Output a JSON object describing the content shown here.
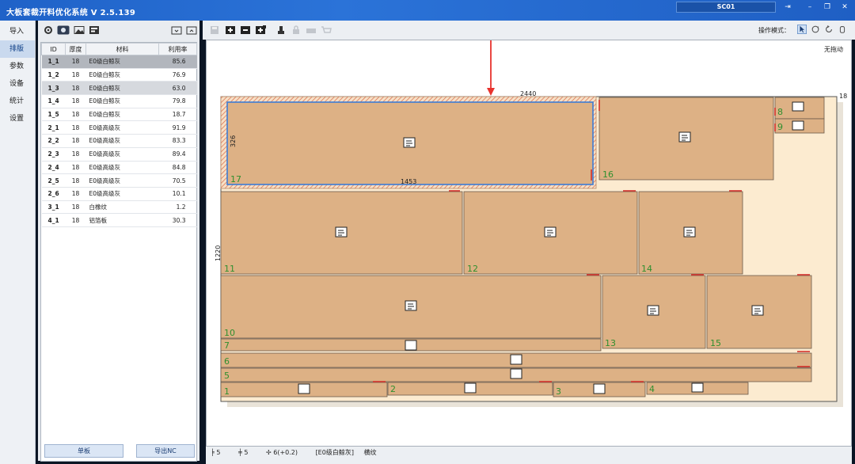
{
  "window": {
    "title": "大板套裁开料优化系统 V 2.5.139",
    "user": "SC01"
  },
  "nav": {
    "items": [
      {
        "label": "导入"
      },
      {
        "label": "排版"
      },
      {
        "label": "参数"
      },
      {
        "label": "设备"
      },
      {
        "label": "统计"
      },
      {
        "label": "设置"
      }
    ]
  },
  "table": {
    "headers": {
      "id": "ID",
      "thickness": "厚度",
      "material": "材料",
      "rate": "利用率"
    },
    "rows": [
      {
        "id": "1_1",
        "t": "18",
        "m": "E0级白鲸灰",
        "r": "85.6"
      },
      {
        "id": "1_2",
        "t": "18",
        "m": "E0级白鲸灰",
        "r": "76.9"
      },
      {
        "id": "1_3",
        "t": "18",
        "m": "E0级白鲸灰",
        "r": "63.0"
      },
      {
        "id": "1_4",
        "t": "18",
        "m": "E0级白鲸灰",
        "r": "79.8"
      },
      {
        "id": "1_5",
        "t": "18",
        "m": "E0级白鲸灰",
        "r": "18.7"
      },
      {
        "id": "2_1",
        "t": "18",
        "m": "E0级高级灰",
        "r": "91.9"
      },
      {
        "id": "2_2",
        "t": "18",
        "m": "E0级高级灰",
        "r": "83.3"
      },
      {
        "id": "2_3",
        "t": "18",
        "m": "E0级高级灰",
        "r": "89.4"
      },
      {
        "id": "2_4",
        "t": "18",
        "m": "E0级高级灰",
        "r": "84.8"
      },
      {
        "id": "2_5",
        "t": "18",
        "m": "E0级高级灰",
        "r": "70.5"
      },
      {
        "id": "2_6",
        "t": "18",
        "m": "E0级高级灰",
        "r": "10.1"
      },
      {
        "id": "3_1",
        "t": "18",
        "m": "白橡纹",
        "r": "1.2"
      },
      {
        "id": "4_1",
        "t": "18",
        "m": "铝箔板",
        "r": "30.3"
      }
    ]
  },
  "panel_buttons": {
    "left": "单板",
    "right": "导出NC"
  },
  "toolbar": {
    "mode_label": "操作模式："
  },
  "canvas": {
    "no_drag": "无拖动",
    "sheet_width": "2440",
    "sheet_height": "1220",
    "thickness": "18",
    "selected_w": "1453",
    "selected_h": "326",
    "part_labels": [
      "1",
      "2",
      "3",
      "4",
      "5",
      "6",
      "7",
      "8",
      "9",
      "10",
      "11",
      "12",
      "13",
      "14",
      "15",
      "16",
      "17"
    ]
  },
  "status": {
    "count_a": "5",
    "count_b": "5",
    "count_c": "6(+0.2)",
    "material": "[E0级白鲸灰]",
    "grain": "横纹"
  },
  "colors": {
    "titlebar": "#2b73d8",
    "part_fill": "#ddb185",
    "sheet_bg": "#fcebd0",
    "selected_outline": "#3c7cd6",
    "arrow": "#e8322d",
    "part_label": "#2f8f2f"
  }
}
